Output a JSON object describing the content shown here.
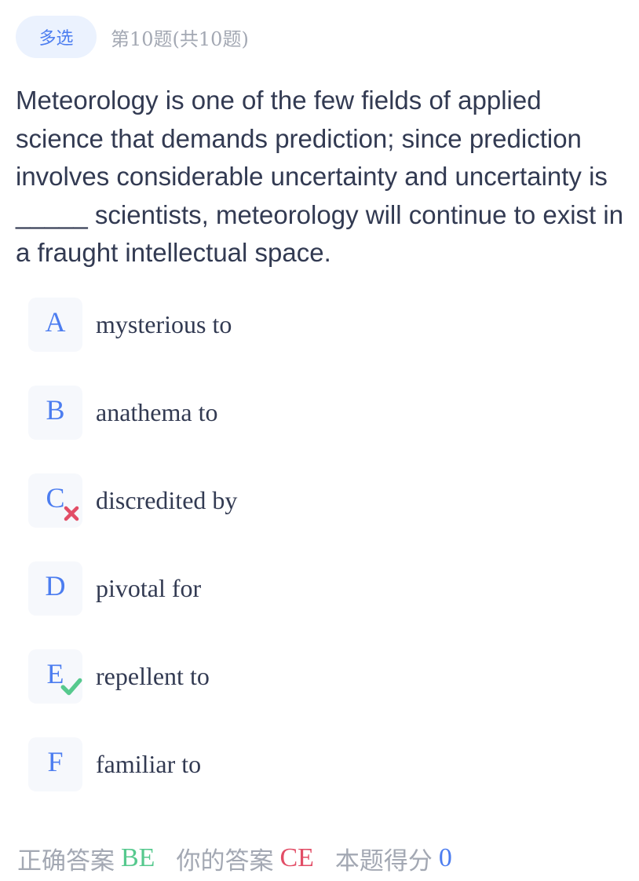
{
  "header": {
    "type_tag": "多选",
    "question_index": "第10题(共10题)"
  },
  "question": {
    "text": "Meteorology is one of the few fields of applied science that demands prediction; since prediction involves considerable uncertainty and uncertainty is _____ scientists, meteorology will continue to exist in a fraught intellectual space."
  },
  "options": [
    {
      "letter": "A",
      "text": "mysterious to",
      "mark": null
    },
    {
      "letter": "B",
      "text": "anathema to",
      "mark": null
    },
    {
      "letter": "C",
      "text": "discredited by",
      "mark": "wrong"
    },
    {
      "letter": "D",
      "text": "pivotal for",
      "mark": null
    },
    {
      "letter": "E",
      "text": "repellent to",
      "mark": "correct"
    },
    {
      "letter": "F",
      "text": "familiar to",
      "mark": null
    }
  ],
  "footer": {
    "correct_label": "正确答案",
    "correct_value": "BE",
    "your_label": "你的答案",
    "your_value": "CE",
    "score_label": "本题得分",
    "score_value": "0"
  },
  "colors": {
    "accent": "#4c7df0",
    "correct": "#56c98e",
    "wrong": "#e24d66",
    "muted": "#a3a8b3",
    "text": "#323a52"
  },
  "icons": {
    "wrong_mark": "close-icon",
    "correct_mark": "check-icon"
  }
}
